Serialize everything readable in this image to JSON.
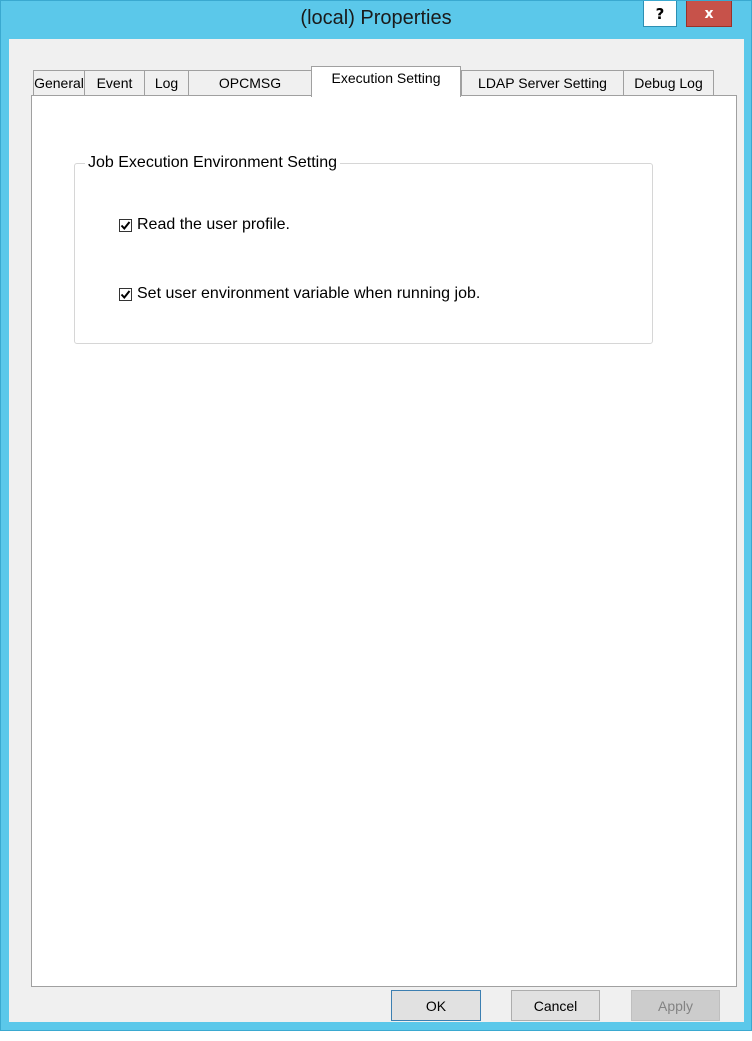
{
  "window": {
    "title": "(local) Properties",
    "help_label": "?",
    "close_label": "x"
  },
  "tabs": [
    {
      "label": "General",
      "active": false
    },
    {
      "label": "Event",
      "active": false
    },
    {
      "label": "Log",
      "active": false
    },
    {
      "label": "OPCMSG",
      "active": false
    },
    {
      "label": "Execution Setting",
      "active": true
    },
    {
      "label": "LDAP Server Setting",
      "active": false
    },
    {
      "label": "Debug Log",
      "active": false
    }
  ],
  "group": {
    "title": "Job Execution Environment Setting",
    "options": [
      {
        "label": "Read the user profile.",
        "checked": true
      },
      {
        "label": "Set user environment variable when running job.",
        "checked": true
      }
    ]
  },
  "buttons": {
    "ok": "OK",
    "cancel": "Cancel",
    "apply": "Apply"
  },
  "colors": {
    "titlebar": "#5bc8ea",
    "close": "#c7524a",
    "dialog_bg": "#f0f0f0"
  }
}
